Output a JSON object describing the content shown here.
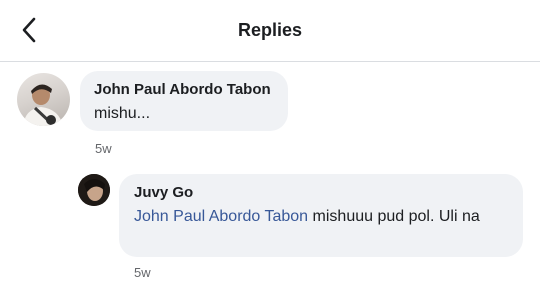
{
  "header": {
    "title": "Replies",
    "back_icon": "chevron-left-icon"
  },
  "comments": [
    {
      "author": "John Paul Abordo Tabon",
      "text": "mishu...",
      "time": "5w"
    },
    {
      "author": "Juvy Go",
      "mention": "John Paul Abordo Tabon",
      "text": "mishuuu pud pol. Uli na",
      "time": "5w"
    }
  ],
  "colors": {
    "bubble": "#f0f2f5",
    "mention": "#385898",
    "timestamp": "#65676b",
    "divider": "#dadde1"
  }
}
